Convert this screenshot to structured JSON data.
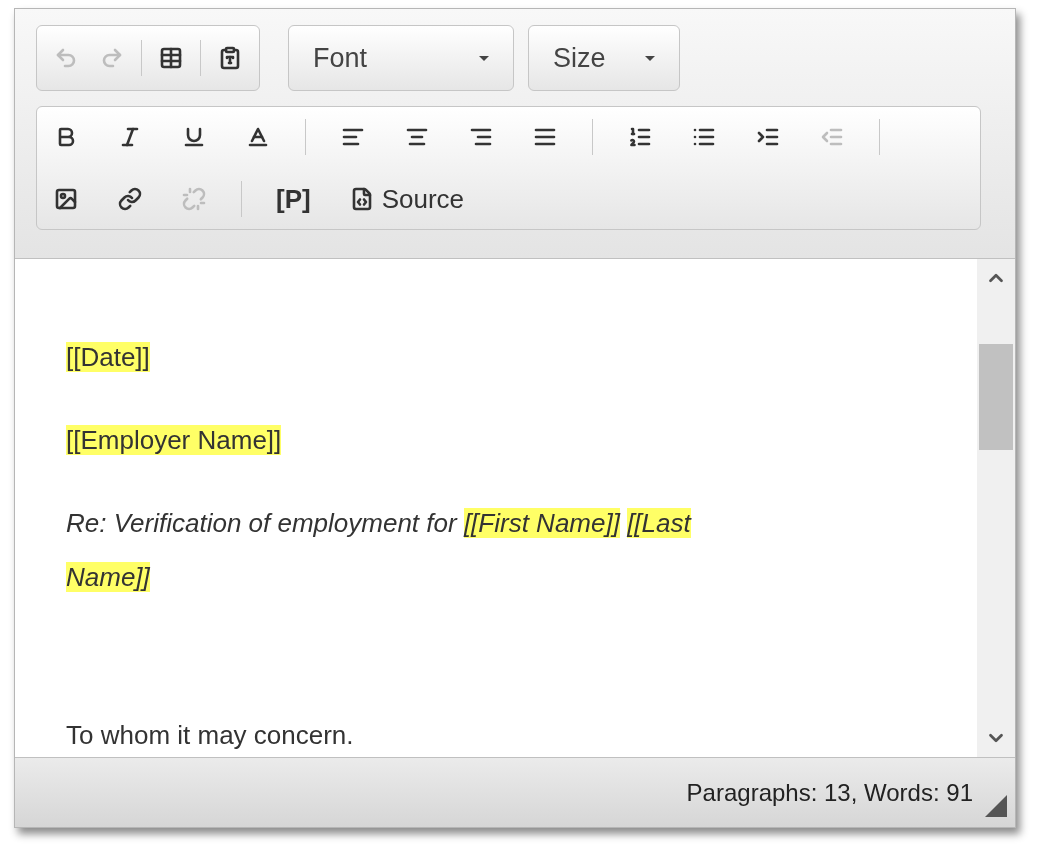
{
  "toolbar_row_1": [
    {
      "kind": "group",
      "buttons": [
        {
          "kind": "button",
          "disabled": true
        },
        {
          "kind": "button",
          "disabled": true
        },
        {
          "kind": "separator"
        },
        {
          "kind": "button",
          "disabled": false
        },
        {
          "kind": "separator"
        },
        {
          "kind": "button",
          "disabled": false
        }
      ]
    },
    {
      "kind": "dropdown",
      "label": "Font"
    },
    {
      "kind": "dropdown",
      "label": "Size"
    }
  ],
  "toolbar_row_2": [
    [
      {
        "kind": "button",
        "disabled": false
      },
      {
        "kind": "button",
        "disabled": false
      },
      {
        "kind": "button",
        "disabled": false
      },
      {
        "kind": "button",
        "disabled": false
      },
      {
        "kind": "separator"
      },
      {
        "kind": "button",
        "disabled": false
      },
      {
        "kind": "button",
        "disabled": false
      },
      {
        "kind": "button",
        "disabled": false
      },
      {
        "kind": "button",
        "disabled": false
      },
      {
        "kind": "separator"
      },
      {
        "kind": "button",
        "disabled": false
      },
      {
        "kind": "button",
        "disabled": false
      },
      {
        "kind": "button",
        "disabled": false
      },
      {
        "kind": "button",
        "disabled": true
      },
      {
        "kind": "separator"
      }
    ],
    [
      {
        "kind": "button",
        "disabled": false
      },
      {
        "kind": "button",
        "disabled": false
      },
      {
        "kind": "button",
        "disabled": true
      },
      {
        "kind": "separator"
      },
      {
        "kind": "text",
        "label": "[P]",
        "disabled": false
      },
      {
        "kind": "button",
        "label": "Source",
        "disabled": false
      }
    ]
  ],
  "content": [
    {
      "italic": false,
      "segments": [
        {
          "text": "[[Date]]",
          "highlight": true
        }
      ]
    },
    {
      "italic": false,
      "segments": [
        {
          "text": "[[Employer Name]]",
          "highlight": true
        }
      ]
    },
    {
      "italic": true,
      "segments": [
        {
          "text": "Re: Verification of employment for",
          "highlight": false
        },
        {
          "text": "[[First Name]]",
          "highlight": true
        },
        {
          "text": "[[Last Name]]",
          "highlight": true
        }
      ]
    },
    {
      "italic": false,
      "segments": [
        {
          "text": "To whom it may concern.",
          "highlight": false
        }
      ]
    }
  ],
  "status_bar": "Paragraphs: 13, Words: 91"
}
